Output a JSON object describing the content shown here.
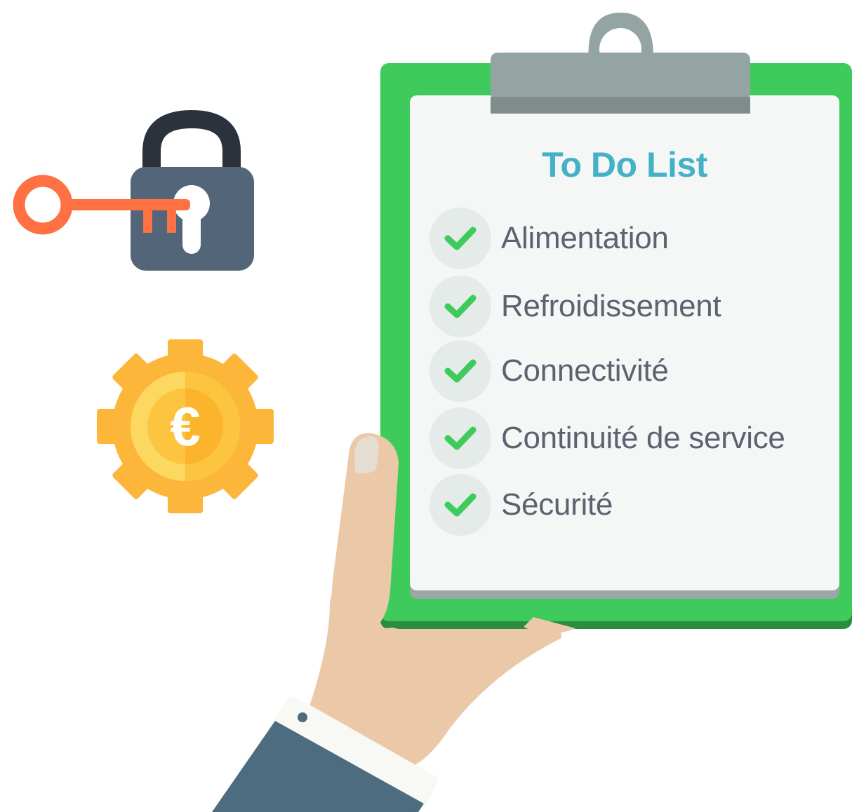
{
  "todo": {
    "title": "To Do List",
    "items": [
      {
        "label": "Alimentation",
        "done": true
      },
      {
        "label": "Refroidissement",
        "done": true
      },
      {
        "label": "Connectivité",
        "done": true
      },
      {
        "label": "Continuité de service",
        "done": true
      },
      {
        "label": "Sécurité",
        "done": true
      }
    ]
  },
  "icons": {
    "lock": "padlock-with-key-icon",
    "gear": "euro-gear-icon",
    "check": "checkmark-icon"
  },
  "colors": {
    "board": "#3fcb5b",
    "title": "#45b1c6",
    "check": "#3fcb5b",
    "item_text": "#5b6270",
    "lock_body": "#536578",
    "key": "#ff7043",
    "gear": "#fcb73b"
  },
  "gear_symbol": "€"
}
